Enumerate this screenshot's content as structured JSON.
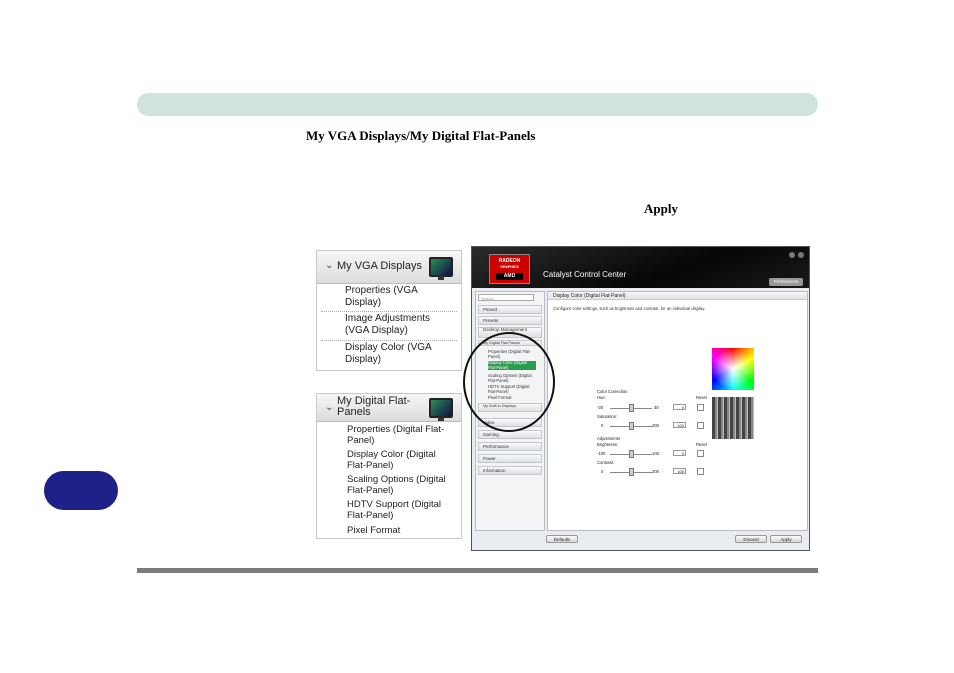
{
  "document": {
    "heading": "My VGA Displays/My Digital Flat-Panels",
    "apply_word": "Apply"
  },
  "vga_panel": {
    "title": "My VGA Displays",
    "items": [
      "Properties (VGA Display)",
      "Image Adjustments (VGA Display)",
      "Display Color (VGA Display)"
    ]
  },
  "flat_panel": {
    "title": "My Digital Flat-Panels",
    "items": [
      "Properties (Digital Flat-Panel)",
      "Display Color (Digital Flat-Panel)",
      "Scaling Options (Digital Flat-Panel)",
      "HDTV Support (Digital Flat-Panel)",
      "Pixel Format"
    ]
  },
  "ccc": {
    "logo_line1": "RADEON",
    "logo_line2": "GRAPHICS",
    "logo_line3": "AMD",
    "app_title": "Catalyst Control Center",
    "preferences": "Preferences",
    "search_placeholder": "Search",
    "nav": [
      "Pinned",
      "Presets",
      "Desktop Management",
      "My Digital Flat-Panels",
      "My Built-in Displays",
      "Video",
      "Gaming",
      "Performance",
      "Power",
      "Information"
    ],
    "nav_sub": [
      "Properties (Digital Flat-Panel)",
      "Display Color (Digital Flat-Panel)",
      "Scaling Options (Digital Flat-Panel)",
      "HDTV Support (Digital Flat-Panel)",
      "Pixel Format"
    ],
    "page_title": "Display Color (Digital Flat-Panel)",
    "description": "Configure color settings, such as brightness and contrast, for an individual display.",
    "color_correction": "Color Correction",
    "hue_label": "Hue:",
    "hue_min": "-30",
    "hue_max": "30",
    "hue_value": "0",
    "saturation_label": "Saturation:",
    "saturation_min": "0",
    "saturation_max": "200",
    "saturation_value": "100",
    "adjustments": "Adjustments",
    "brightness_label": "Brightness:",
    "brightness_min": "-100",
    "brightness_max": "100",
    "brightness_value": "0",
    "contrast_label": "Contrast:",
    "contrast_min": "0",
    "contrast_max": "200",
    "contrast_value": "100",
    "reset": "Reset",
    "defaults_button": "Defaults",
    "discard_button": "Discard",
    "apply_button": "Apply"
  }
}
